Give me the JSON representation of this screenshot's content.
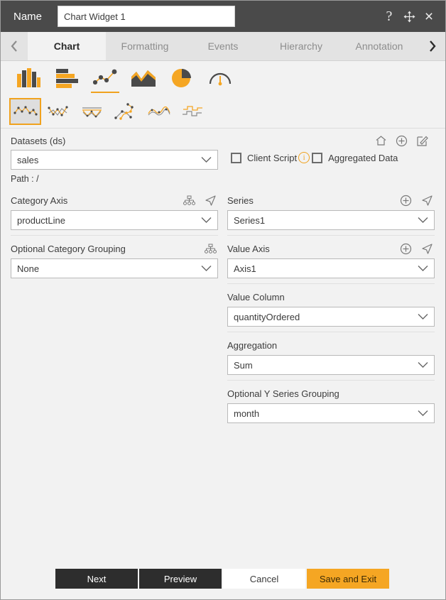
{
  "titlebar": {
    "name_label": "Name",
    "widget_name": "Chart Widget 1",
    "name_placeholder": "Chart Widget 1",
    "help_glyph": "?",
    "close_glyph": "×"
  },
  "tabbar": {
    "prev_label": "‹",
    "next_label": "›",
    "tabs": [
      {
        "label": "Chart",
        "active": true
      },
      {
        "label": "Formatting",
        "active": false
      },
      {
        "label": "Events",
        "active": false
      },
      {
        "label": "Hierarchy",
        "active": false
      },
      {
        "label": "Annotation",
        "active": false
      }
    ]
  },
  "chart_types": {
    "items": [
      {
        "name": "column-chart-icon",
        "selected": false
      },
      {
        "name": "bar-chart-icon",
        "selected": false
      },
      {
        "name": "line-scatter-chart-icon",
        "selected": true
      },
      {
        "name": "area-chart-icon",
        "selected": false
      },
      {
        "name": "pie-chart-icon",
        "selected": false
      },
      {
        "name": "gauge-chart-icon",
        "selected": false
      }
    ],
    "subtypes": [
      {
        "name": "line-markers-icon",
        "selected": true
      },
      {
        "name": "line-zigzag-icon",
        "selected": false
      },
      {
        "name": "line-range-icon",
        "selected": false
      },
      {
        "name": "scatter-connected-icon",
        "selected": false
      },
      {
        "name": "spline-icon",
        "selected": false
      },
      {
        "name": "step-line-icon",
        "selected": false
      }
    ]
  },
  "datasets": {
    "label": "Datasets (ds)",
    "icons": [
      "home-icon",
      "add-icon",
      "edit-icon"
    ],
    "selected": "sales",
    "path_label": "Path :",
    "path_value": "/",
    "client_script": {
      "label": "Client Script",
      "checked": false,
      "info": "i"
    },
    "aggregated_data": {
      "label": "Aggregated Data",
      "checked": false
    }
  },
  "left_column": {
    "category_axis": {
      "title": "Category Axis",
      "value": "productLine",
      "icons": [
        "hierarchy-icon",
        "navigate-icon"
      ]
    },
    "optional_category_grouping": {
      "title": "Optional Category Grouping",
      "value": "None",
      "icons": [
        "hierarchy-icon"
      ]
    }
  },
  "right_column": {
    "series": {
      "title": "Series",
      "value": "Series1",
      "icons": [
        "add-icon",
        "navigate-icon"
      ]
    },
    "value_axis": {
      "title": "Value Axis",
      "value": "Axis1",
      "icons": [
        "add-icon",
        "navigate-icon"
      ]
    },
    "value_column": {
      "title": "Value Column",
      "value": "quantityOrdered"
    },
    "aggregation": {
      "title": "Aggregation",
      "value": "Sum"
    },
    "optional_y_series_grouping": {
      "title": "Optional Y Series Grouping",
      "value": "month"
    }
  },
  "footer": {
    "next": "Next",
    "preview": "Preview",
    "cancel": "Cancel",
    "save_and_exit": "Save and Exit"
  },
  "colors": {
    "accent": "#f5a623",
    "titlebar_bg": "#4a4a4a",
    "panel_bg": "#f2f2f2",
    "dark_button": "#2d2d2d",
    "icon_gray": "#4a4a4a"
  }
}
